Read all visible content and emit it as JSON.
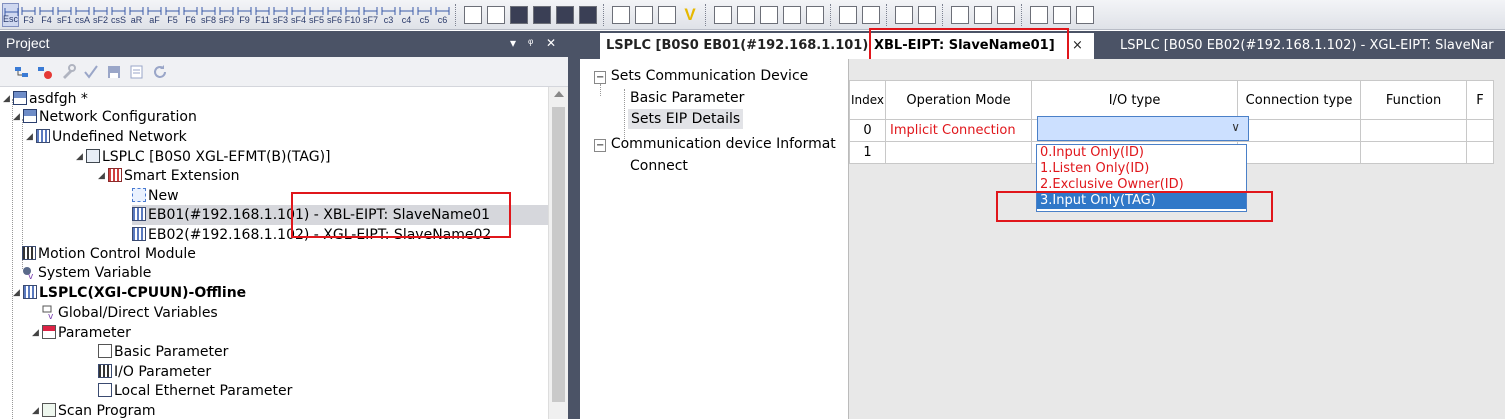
{
  "toolbar": {
    "keys": [
      "Esc",
      "F3",
      "F4",
      "sF1",
      "csA",
      "sF2",
      "csS",
      "aR",
      "aF",
      "F5",
      "F6",
      "sF8",
      "sF9",
      "F9",
      "F11",
      "sF3",
      "sF4",
      "sF5",
      "sF6",
      "F10",
      "sF7",
      "c3",
      "c4",
      "c5",
      "c6"
    ]
  },
  "project_panel": {
    "title": "Project",
    "pin": "▾   ∕  ×"
  },
  "tree": {
    "root": "asdfgh *",
    "network_config": "Network Configuration",
    "undefined_network": "Undefined Network",
    "lsplc_module": "LSPLC [B0S0 XGL-EFMT(B)(TAG)]",
    "smart_extension": "Smart Extension",
    "new": "New",
    "eb01": "EB01(#192.168.1.101) - XBL-EIPT: SlaveName01",
    "eb02": "EB02(#192.168.1.102) - XGL-EIPT: SlaveName02",
    "motion": "Motion Control Module",
    "system_variable": "System Variable",
    "cpu": "LSPLC(XGI-CPUUN)-Offline",
    "global_vars": "Global/Direct Variables",
    "parameter": "Parameter",
    "basic_param": "Basic Parameter",
    "io_param": "I/O Parameter",
    "local_eth": "Local Ethernet Parameter",
    "scan_program": "Scan Program"
  },
  "tabs": {
    "tab1": "LSPLC [B0S0 EB01(#192.168.1.101) -",
    "tab1_active": "XBL-EIPT: SlaveName01]",
    "tab_close": "×",
    "tab2": "LSPLC [B0S0 EB02(#192.168.1.102) - XGL-EIPT: SlaveNar"
  },
  "comm_tree": {
    "root": "Sets Communication Device",
    "basic": "Basic Parameter",
    "eip": "Sets EIP Details",
    "info": "Communication device Informat",
    "connect": "Connect"
  },
  "grid": {
    "headers": [
      "Index",
      "Operation Mode",
      "I/O type",
      "Connection type",
      "Function",
      "F"
    ],
    "rows": [
      {
        "index": "0",
        "mode": "Implicit Connection"
      },
      {
        "index": "1",
        "mode": ""
      }
    ]
  },
  "dropdown": {
    "options": [
      "0.Input Only(ID)",
      "1.Listen Only(ID)",
      "2.Exclusive Owner(ID)",
      "3.Input Only(TAG)"
    ],
    "selected_index": 3
  },
  "colors": {
    "highlight_red": "#e0161b",
    "panel_dark": "#4b5366",
    "select_blue": "#3078c8"
  }
}
